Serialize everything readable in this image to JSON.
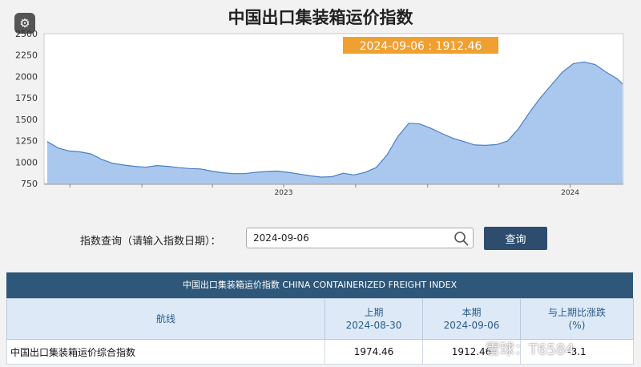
{
  "title": "中国出口集装箱运价指数",
  "tooltip": "2024-09-06 : 1912.46",
  "query": {
    "label": "指数查询（请输入指数日期）：",
    "value": "2024-09-06",
    "button": "查询"
  },
  "table": {
    "caption": "中国出口集装箱运价指数 CHINA CONTAINERIZED FREIGHT INDEX",
    "headers": [
      "航线",
      "上期\n2024-08-30",
      "本期\n2024-09-06",
      "与上期比涨跌\n(%)"
    ],
    "rows": [
      {
        "name": "中国出口集装箱运价综合指数",
        "prev": "1974.46",
        "curr": "1912.46",
        "chg": "-3.1"
      }
    ]
  },
  "watermark": "雪球：T6584",
  "colors": {
    "area": "#aac8ee",
    "line": "#4a7fc2",
    "tooltip_bg": "#f0a030",
    "header": "#2e5779"
  },
  "chart_data": {
    "type": "area",
    "title": "中国出口集装箱运价指数",
    "xlabel": "",
    "ylabel": "",
    "ylim": [
      750,
      2500
    ],
    "yticks": [
      750,
      1000,
      1250,
      1500,
      1750,
      2000,
      2250,
      2500
    ],
    "x_tick_labels": [
      "2023",
      "2024"
    ],
    "grid": false,
    "series": [
      {
        "x": [
          "2022-09-02",
          "2022-09-16",
          "2022-09-30",
          "2022-10-14",
          "2022-10-28",
          "2022-11-11",
          "2022-11-25",
          "2022-12-09",
          "2022-12-23",
          "2023-01-06",
          "2023-01-20",
          "2023-02-03",
          "2023-02-17",
          "2023-03-03",
          "2023-03-17",
          "2023-03-31",
          "2023-04-14",
          "2023-04-28",
          "2023-05-12",
          "2023-05-26",
          "2023-06-09",
          "2023-06-23",
          "2023-07-07",
          "2023-07-21",
          "2023-08-04",
          "2023-08-18",
          "2023-09-01",
          "2023-09-15",
          "2023-09-29",
          "2023-10-13",
          "2023-10-27",
          "2023-11-10",
          "2023-11-24",
          "2023-12-08",
          "2023-12-22",
          "2024-01-05",
          "2024-01-19",
          "2024-02-02",
          "2024-02-16",
          "2024-03-01",
          "2024-03-15",
          "2024-03-29",
          "2024-04-12",
          "2024-04-26",
          "2024-05-10",
          "2024-05-24",
          "2024-06-07",
          "2024-06-21",
          "2024-07-05",
          "2024-07-19",
          "2024-08-02",
          "2024-08-16",
          "2024-08-30",
          "2024-09-06"
        ],
        "values": [
          1240,
          1165,
          1130,
          1120,
          1095,
          1030,
          985,
          965,
          950,
          940,
          960,
          950,
          935,
          925,
          920,
          895,
          875,
          865,
          865,
          880,
          890,
          895,
          880,
          860,
          840,
          825,
          830,
          870,
          850,
          880,
          935,
          1080,
          1300,
          1455,
          1445,
          1395,
          1335,
          1280,
          1240,
          1200,
          1195,
          1205,
          1245,
          1390,
          1580,
          1750,
          1900,
          2050,
          2150,
          2170,
          2140,
          2050,
          1974.46,
          1912.46
        ]
      }
    ]
  }
}
